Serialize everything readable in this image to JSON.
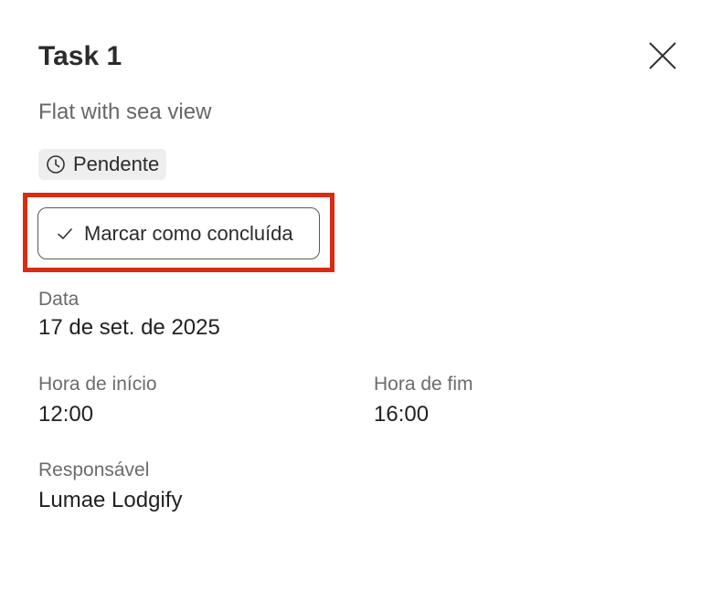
{
  "task": {
    "title": "Task 1",
    "subtitle": "Flat with sea view",
    "status": {
      "label": "Pendente",
      "icon": "clock-icon"
    },
    "complete_button": {
      "label": "Marcar como concluída",
      "icon": "check-icon"
    },
    "fields": {
      "date": {
        "label": "Data",
        "value": "17 de set. de 2025"
      },
      "start_time": {
        "label": "Hora de início",
        "value": "12:00"
      },
      "end_time": {
        "label": "Hora de fim",
        "value": "16:00"
      },
      "assignee": {
        "label": "Responsável",
        "value": "Lumae Lodgify"
      }
    }
  },
  "colors": {
    "highlight": "#d92b12",
    "badge_bg": "#eeeeee",
    "muted_text": "#6b6b6b"
  }
}
